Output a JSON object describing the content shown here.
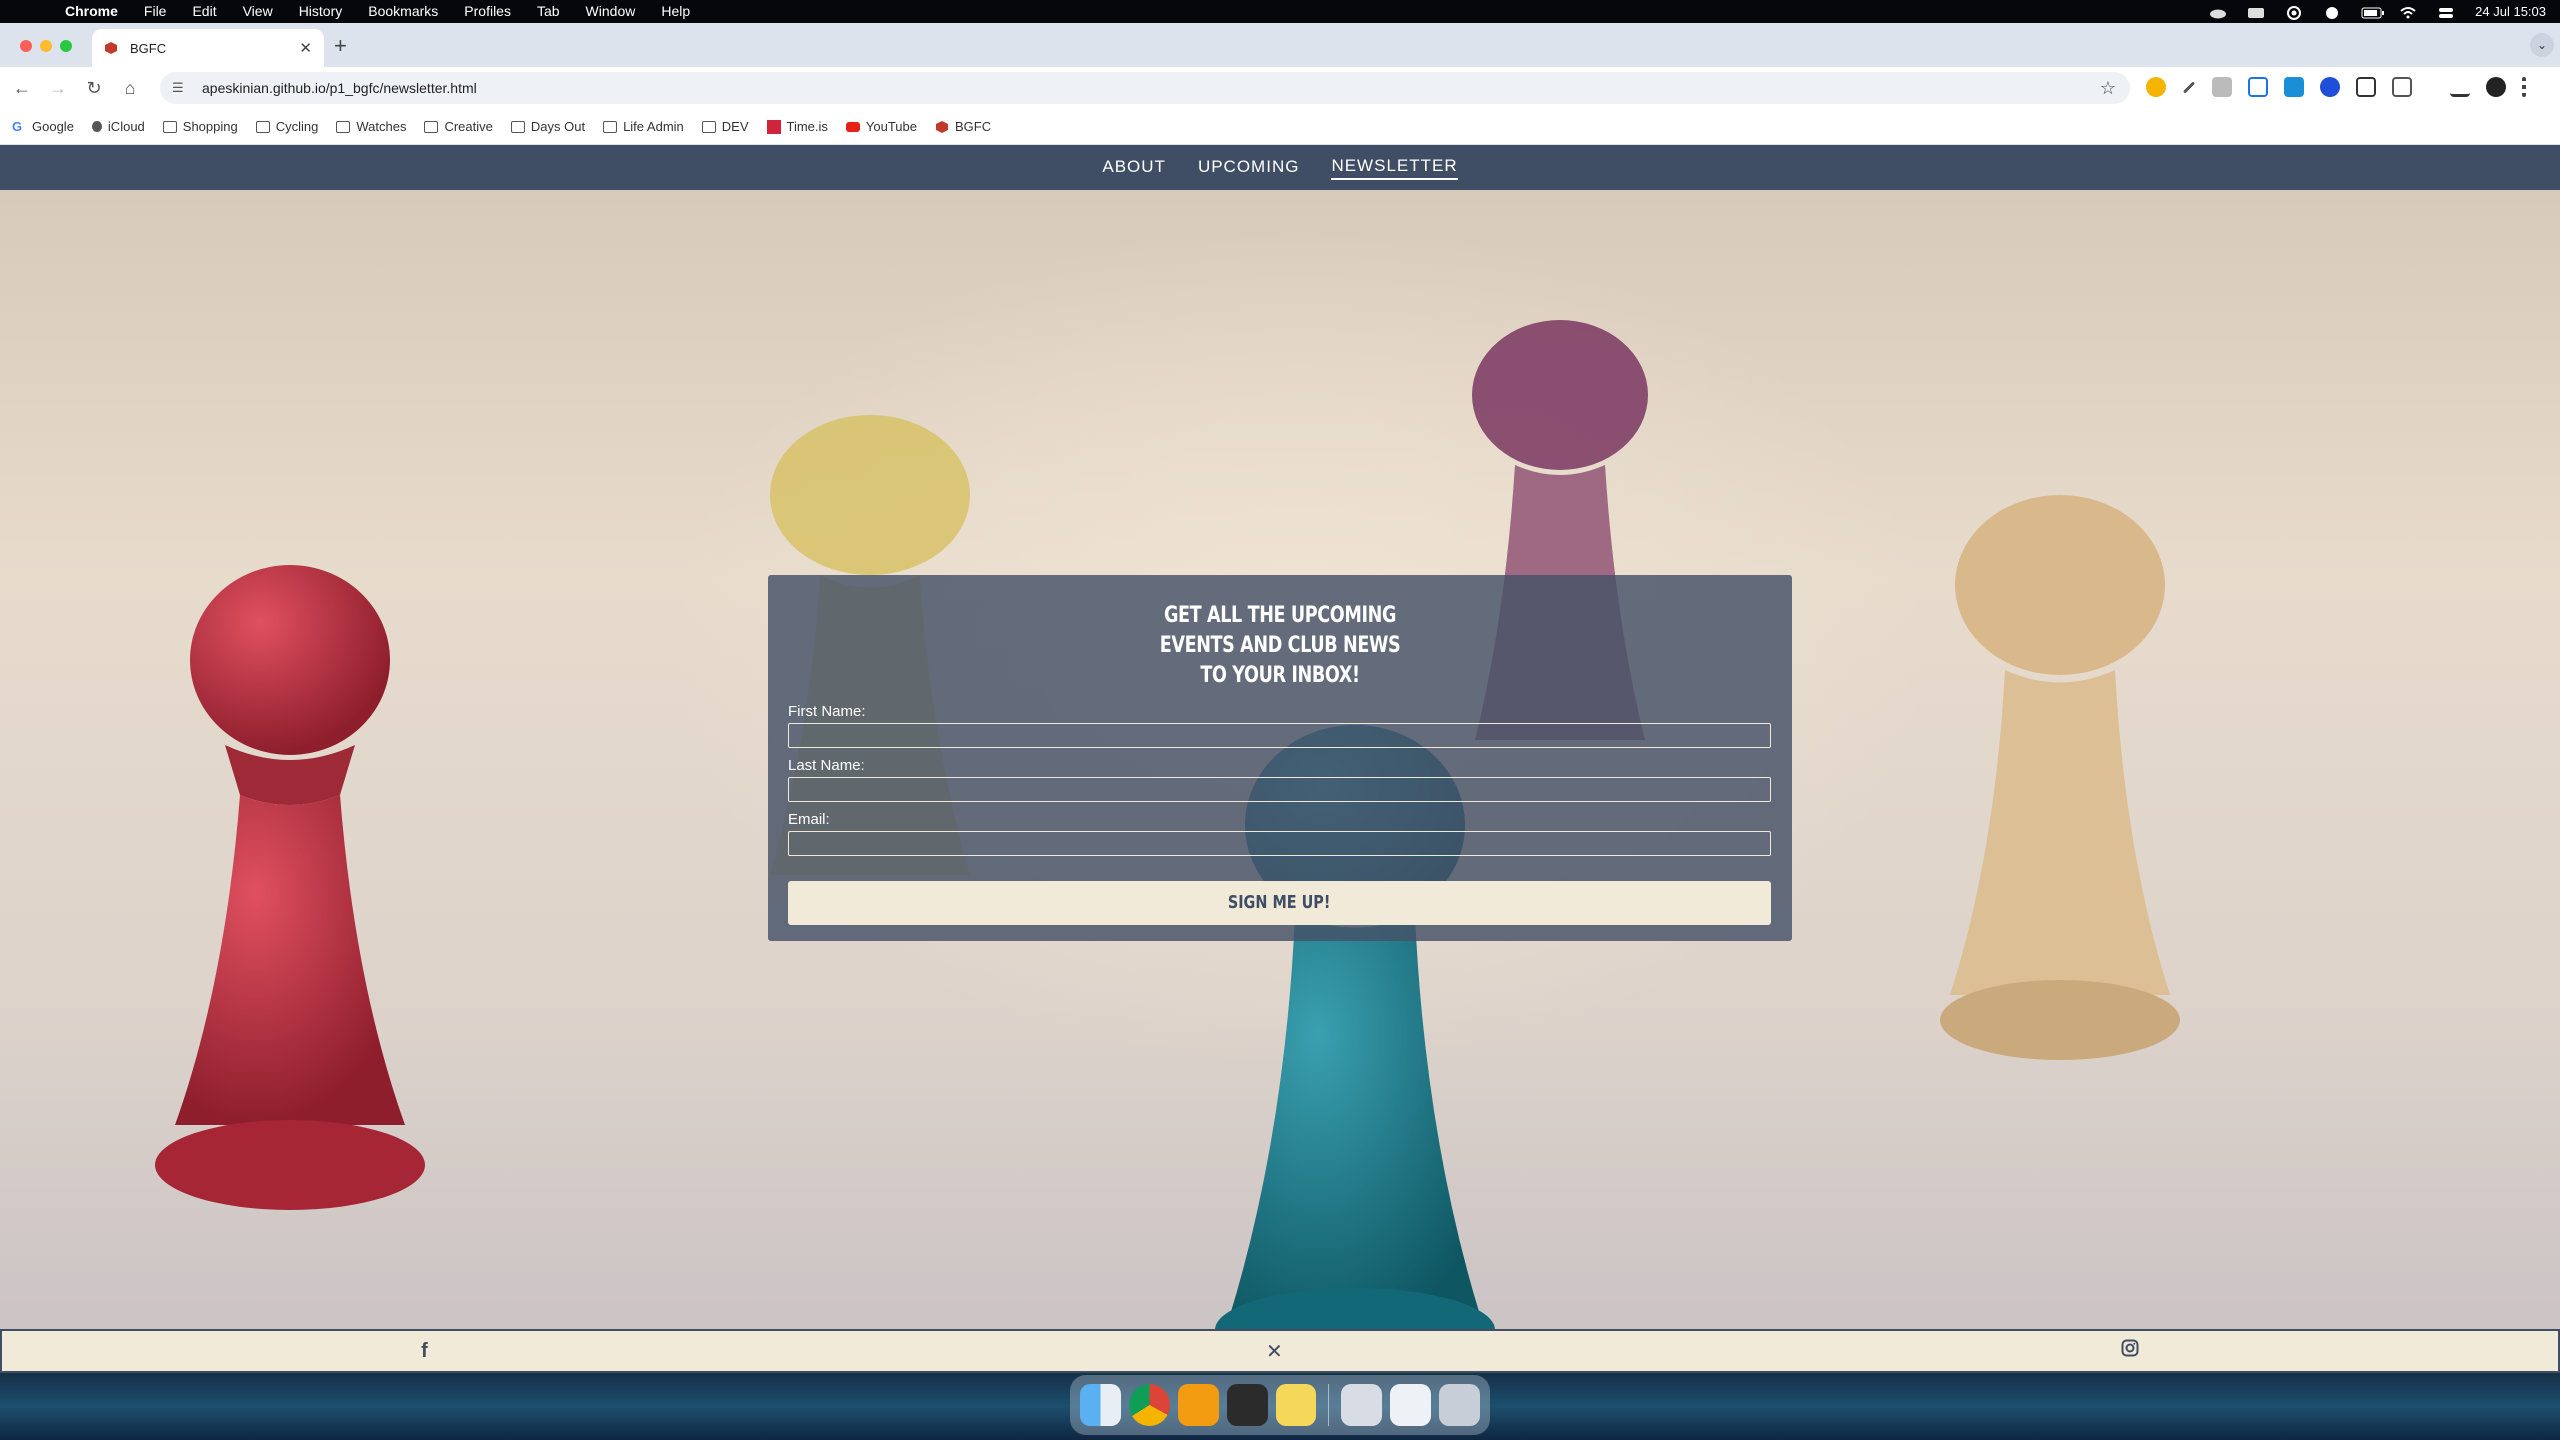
{
  "menubar": {
    "app_name": "Chrome",
    "items": [
      "File",
      "Edit",
      "View",
      "History",
      "Bookmarks",
      "Profiles",
      "Tab",
      "Window",
      "Help"
    ],
    "datetime": "24 Jul  15:03"
  },
  "browser": {
    "tab_title": "BGFC",
    "url": "apeskinian.github.io/p1_bgfc/newsletter.html",
    "bookmarks": [
      "Google",
      "iCloud",
      "Shopping",
      "Cycling",
      "Watches",
      "Creative",
      "Days Out",
      "Life Admin",
      "DEV",
      "Time.is",
      "YouTube",
      "BGFC"
    ]
  },
  "site": {
    "nav": [
      "ABOUT",
      "UPCOMING",
      "NEWSLETTER"
    ],
    "active_nav": "NEWSLETTER",
    "form": {
      "heading_line1": "GET ALL THE UPCOMING",
      "heading_line2": "EVENTS AND CLUB NEWS",
      "heading_line3": "TO YOUR INBOX!",
      "first_name_label": "First Name:",
      "first_name_value": "",
      "last_name_label": "Last Name:",
      "last_name_value": "",
      "email_label": "Email:",
      "email_value": "",
      "submit_label": "SIGN ME UP!"
    },
    "footer_icons": [
      "facebook-icon",
      "x-twitter-icon",
      "instagram-icon"
    ]
  },
  "colors": {
    "nav_bg": "#3f4e65",
    "form_bg": "#465268",
    "cream": "#f2ead8"
  }
}
